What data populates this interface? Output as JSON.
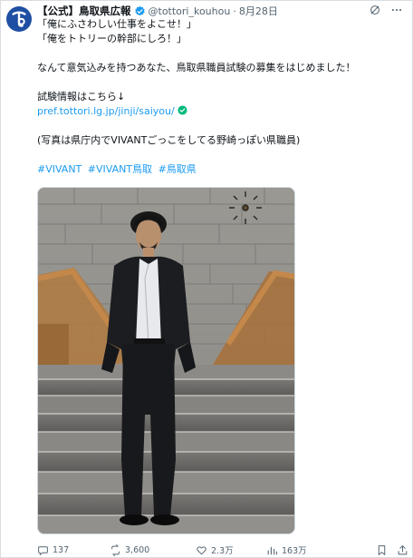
{
  "account": {
    "display_name": "【公式】鳥取県広報",
    "handle": "@tottori_kouhou",
    "separator": "·",
    "date": "8月28日"
  },
  "tweet": {
    "lines": [
      "「俺にふさわしい仕事をよこせ！」",
      "「俺をトトリーの幹部にしろ！」",
      "なんて意気込みを持つあなた、鳥取県職員試験の募集をはじめました！",
      "試験情報はこちら↓",
      "pref.tottori.lg.jp/jinji/saiyou/",
      "(写真は県庁内でVIVANTごっこをしてる野崎っぽい県職員)"
    ],
    "hashtags": [
      "#VIVANT",
      "#VIVANT鳥取",
      "#鳥取県"
    ]
  },
  "stats": {
    "replies": "137",
    "reposts": "3,600",
    "likes": "2.3万",
    "views": "163万"
  },
  "colors": {
    "link": "#1d9bf0",
    "verified": "#1d9bf0",
    "text": "#0f1419",
    "muted": "#536471",
    "avatar": "#1f4fa3"
  },
  "icons": {
    "avatar": "tottori-logo",
    "verified": "verified-badge-icon",
    "grok": "grok-icon",
    "more": "more-icon",
    "link_check": "check-circle-icon",
    "reply": "reply-icon",
    "repost": "repost-icon",
    "like": "heart-icon",
    "views": "views-icon",
    "bookmark": "bookmark-icon",
    "share": "share-icon"
  }
}
